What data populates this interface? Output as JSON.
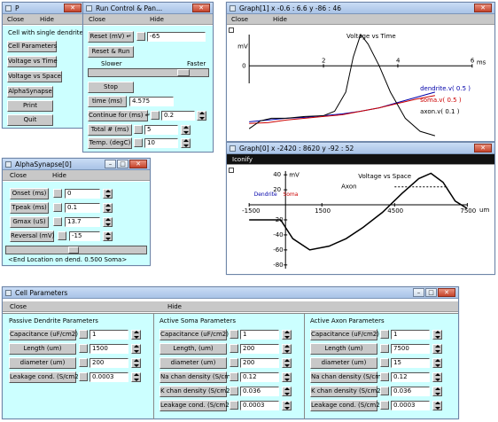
{
  "main_panel": {
    "title": "P",
    "menu_close": "Close",
    "menu_hide": "Hide",
    "label": "Cell with single dendrite",
    "buttons": [
      "Cell Parameters",
      "Voltage vs Time",
      "Voltage vs Space",
      "AlphaSynapse",
      "Print",
      "Quit"
    ]
  },
  "run_control": {
    "title": "Run Control & Pan...",
    "menu_close": "Close",
    "menu_hide": "Hide",
    "reset_label": "Reset (mV)",
    "reset_value": "-65",
    "reset_run": "Reset & Run",
    "slower": "Slower",
    "faster": "Faster",
    "stop": "Stop",
    "time_label": "time (ms)",
    "time_value": "4.575",
    "continue_label": "Continue for (ms)",
    "continue_value": "0.2",
    "total_label": "Total # (ms)",
    "total_value": "5",
    "temp_label": "Temp. (degC)",
    "temp_value": "10"
  },
  "graph1": {
    "title": "Graph[1]  x -0.6 : 6.6  y -86 : 46",
    "menu_close": "Close",
    "menu_hide": "Hide"
  },
  "graph0": {
    "title": "Graph[0]  x -2420 : 8620  y -92 : 52",
    "menu_iconify": "Iconify"
  },
  "alpha": {
    "title": "AlphaSynapse[0]",
    "menu_close": "Close",
    "menu_hide": "Hide",
    "fields": [
      {
        "label": "Onset (ms)",
        "value": "0"
      },
      {
        "label": "Tpeak (ms)",
        "value": "0.1"
      },
      {
        "label": "Gmax (uS)",
        "value": "13.7"
      },
      {
        "label": "Reversal (mV)",
        "value": "-15"
      }
    ],
    "status": "<End   Location on dend.     0.500    Soma>"
  },
  "cellparams": {
    "title": "Cell Parameters",
    "menu_close": "Close",
    "menu_hide": "Hide",
    "columns": [
      {
        "heading": "Passive Dendrite Parameters",
        "rows": [
          {
            "label": "Capacitance (uF/cm2)",
            "value": "1"
          },
          {
            "label": "Length (um)",
            "value": "1500"
          },
          {
            "label": "diameter (um)",
            "value": "200"
          },
          {
            "label": "Leakage cond. (S/cm2)",
            "value": "0.0003"
          }
        ]
      },
      {
        "heading": "Active Soma Parameters",
        "rows": [
          {
            "label": "Capacitance (uF/cm2)",
            "value": "1"
          },
          {
            "label": "Length, (um)",
            "value": "200"
          },
          {
            "label": "diameter (um)",
            "value": "200"
          },
          {
            "label": "Na chan density (S/cm2)",
            "value": "0.12"
          },
          {
            "label": "K chan density (S/cm2)",
            "value": "0.036"
          },
          {
            "label": "Leakage cond. (S/cm2)",
            "value": "0.0003"
          }
        ]
      },
      {
        "heading": "Active Axon Parameters",
        "rows": [
          {
            "label": "Capacitance (uF/cm2)",
            "value": "1"
          },
          {
            "label": "Length (um)",
            "value": "7500"
          },
          {
            "label": "diameter (um)",
            "value": "15"
          },
          {
            "label": "Na chan density (S/cm2)",
            "value": "0.12"
          },
          {
            "label": "K chan density (S/cm2)",
            "value": "0.036"
          },
          {
            "label": "Leakage cond. (S/cm2)",
            "value": "0.0003"
          }
        ]
      }
    ]
  },
  "chart_data": [
    {
      "type": "line",
      "title": "Voltage vs Time",
      "ylabel": "mV",
      "xlabel": "ms",
      "xlim": [
        -0.6,
        6.6
      ],
      "ylim": [
        -86,
        46
      ],
      "x_ticks": [
        "2",
        "4",
        "6"
      ],
      "y_ticks": [
        "0"
      ],
      "series": [
        {
          "name": "dendrite.v( 0.5 )",
          "color": "#0000aa",
          "x": [
            0,
            0.5,
            1,
            1.5,
            2,
            2.5,
            3,
            3.5,
            4,
            4.5,
            5
          ],
          "values": [
            -64,
            -62,
            -60,
            -59,
            -57,
            -55,
            -52,
            -48,
            -42,
            -36,
            -30
          ]
        },
        {
          "name": "soma.v( 0.5 )",
          "color": "#cc0000",
          "x": [
            0,
            0.5,
            1,
            1.5,
            2,
            2.5,
            3,
            3.5,
            4,
            4.5,
            5
          ],
          "values": [
            -66,
            -65,
            -62,
            -60,
            -58,
            -56,
            -52,
            -48,
            -43,
            -38,
            -34
          ]
        },
        {
          "name": "axon.v( 0.1 )",
          "color": "#000000",
          "x": [
            0,
            0.3,
            0.6,
            1,
            1.5,
            2,
            2.3,
            2.6,
            2.8,
            3,
            3.2,
            3.5,
            3.8,
            4.2,
            4.6,
            5
          ],
          "values": [
            -72,
            -63,
            -60,
            -60,
            -58,
            -57,
            -52,
            -30,
            10,
            36,
            25,
            0,
            -30,
            -60,
            -75,
            -80
          ]
        }
      ]
    },
    {
      "type": "line",
      "title": "Voltage vs Space",
      "ylabel": "mV",
      "xlabel": "um",
      "xlim": [
        -2420,
        8620
      ],
      "ylim": [
        -92,
        52
      ],
      "x_ticks": [
        "-1500",
        "1500",
        "4500",
        "7500"
      ],
      "y_ticks": [
        "40",
        "20",
        "-20",
        "-40",
        "-60",
        "-80"
      ],
      "annotations": [
        "Dendrite",
        "Soma",
        "Axon"
      ],
      "series": [
        {
          "name": "v",
          "color": "#000000",
          "x": [
            -1500,
            -200,
            0,
            300,
            1000,
            1800,
            2500,
            3200,
            4000,
            4800,
            5500,
            6000,
            6500,
            7000,
            7500
          ],
          "values": [
            -20,
            -20,
            -30,
            -45,
            -60,
            -55,
            -45,
            -30,
            -10,
            15,
            35,
            42,
            30,
            5,
            -5
          ]
        }
      ]
    }
  ]
}
